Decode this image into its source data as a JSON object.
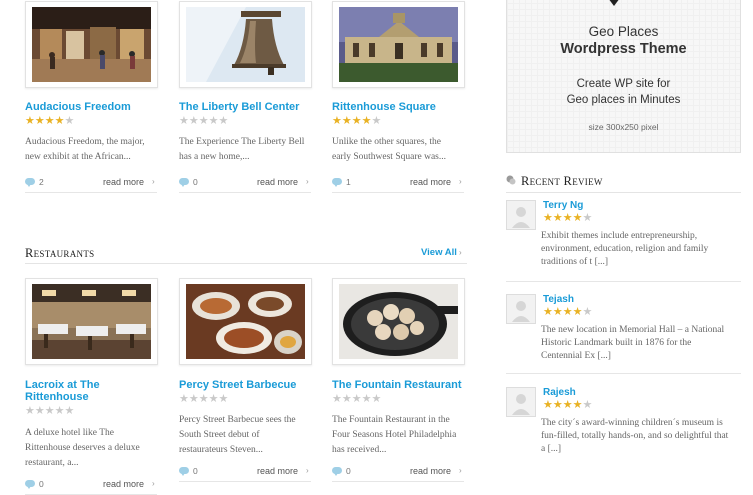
{
  "row1": [
    {
      "title": "Audacious Freedom",
      "rating": 4,
      "desc": [
        "Audacious Freedom, the major,",
        "new exhibit at the African..."
      ],
      "comments": "2",
      "read_more": "read more"
    },
    {
      "title": "The Liberty Bell Center",
      "rating": 0,
      "desc": [
        "The Experience The Liberty Bell",
        "has a new home,..."
      ],
      "comments": "0",
      "read_more": "read more"
    },
    {
      "title": "Rittenhouse Square",
      "rating": 4,
      "desc": [
        "Unlike the other squares, the",
        "early Southwest Square was..."
      ],
      "comments": "1",
      "read_more": "read more"
    }
  ],
  "restaurants": {
    "heading": "Restaurants",
    "view_all": "View All",
    "items": [
      {
        "title_lines": [
          "Lacroix at The",
          "Rittenhouse"
        ],
        "rating": 0,
        "desc": [
          "A deluxe hotel like The",
          "Rittenhouse deserves a deluxe",
          "restaurant, a..."
        ],
        "comments": "0",
        "read_more": "read more"
      },
      {
        "title_lines": [
          "Percy Street Barbecue"
        ],
        "rating": 0,
        "desc": [
          "Percy Street Barbecue sees the",
          "South Street debut of",
          "restaurateurs Steven..."
        ],
        "comments": "0",
        "read_more": "read more"
      },
      {
        "title_lines": [
          "The Fountain Restaurant"
        ],
        "rating": 0,
        "desc": [
          "The Fountain Restaurant in the",
          "Four Seasons Hotel Philadelphia",
          "has received..."
        ],
        "comments": "0",
        "read_more": "read more"
      }
    ]
  },
  "ad": {
    "line1": "Geo Places",
    "line2": "Wordpress Theme",
    "line3": "Create WP site for",
    "line4": "Geo places in Minutes",
    "size": "size 300x250 pixel"
  },
  "recent_review": {
    "heading": "Recent Review",
    "reviews": [
      {
        "name": "Terry Ng",
        "rating": 4,
        "text": [
          "Exhibit themes include entrepreneurship,",
          "environment, education, religion and family",
          "traditions of t [...]"
        ]
      },
      {
        "name": "Tejash",
        "rating": 4,
        "text": [
          "The new location in Memorial Hall – a National",
          "Historic Landmark built in 1876 for the",
          "Centennial Ex [...]"
        ]
      },
      {
        "name": "Rajesh",
        "rating": 4,
        "text": [
          "The city´s award-winning children´s museum is",
          "fun-filled, totally hands-on, and so delightful that",
          "a [...]"
        ]
      }
    ]
  },
  "colors": {
    "link": "#1a9bd7",
    "star_on": "#e9b224",
    "star_off": "#c9c9c9",
    "bubble": "#9fcfe6"
  },
  "icons": [
    "comment-bubble-icon",
    "chevron-right-icon",
    "star-icon",
    "review-bubbles-icon",
    "map-pin-icon",
    "avatar-placeholder-icon"
  ]
}
